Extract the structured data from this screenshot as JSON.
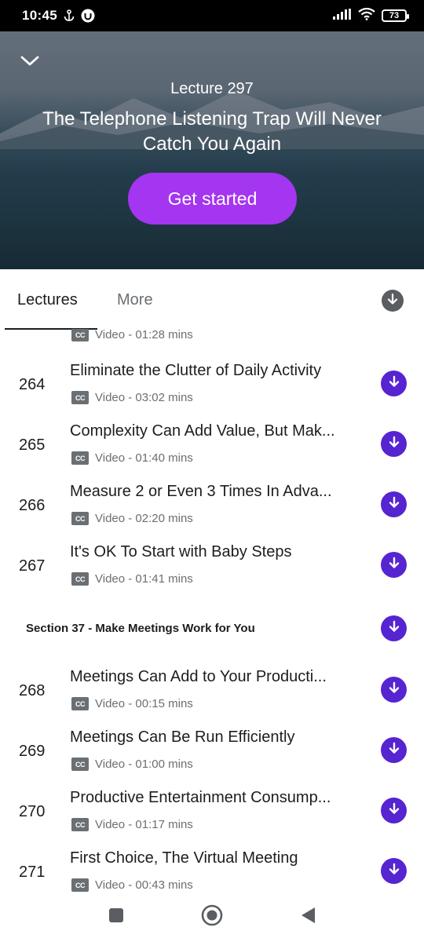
{
  "status_bar": {
    "time": "10:45",
    "battery": "73",
    "icons": [
      "anchor-icon",
      "app-notification-icon",
      "signal-icon",
      "wifi-icon",
      "battery-icon"
    ]
  },
  "hero": {
    "lecture_label": "Lecture 297",
    "title": "The Telephone Listening Trap Will Never Catch You Again",
    "cta_label": "Get started",
    "accent_color": "#a435f0"
  },
  "tabs": {
    "items": [
      "Lectures",
      "More"
    ],
    "active": "Lectures"
  },
  "list": {
    "download_color": "#5624d0",
    "partial_row": {
      "meta": "Video - 01:28 mins"
    },
    "rows_a": [
      {
        "num": "264",
        "title": "Eliminate the Clutter of Daily Activity",
        "meta": "Video - 03:02 mins"
      },
      {
        "num": "265",
        "title": "Complexity Can Add Value, But Mak...",
        "meta": "Video - 01:40 mins"
      },
      {
        "num": "266",
        "title": "Measure 2 or Even 3 Times In Adva...",
        "meta": "Video - 02:20 mins"
      },
      {
        "num": "267",
        "title": "It's OK To Start with Baby Steps",
        "meta": "Video - 01:41 mins"
      }
    ],
    "section": {
      "title": "Section 37 - Make Meetings Work for You"
    },
    "rows_b": [
      {
        "num": "268",
        "title": "Meetings Can Add to Your Producti...",
        "meta": "Video - 00:15 mins"
      },
      {
        "num": "269",
        "title": "Meetings Can Be Run Efficiently",
        "meta": "Video - 01:00 mins"
      },
      {
        "num": "270",
        "title": "Productive Entertainment Consump...",
        "meta": "Video - 01:17 mins"
      },
      {
        "num": "271",
        "title": "First Choice, The Virtual Meeting",
        "meta": "Video - 00:43 mins"
      }
    ],
    "cc_label": "CC"
  },
  "nav_bar": {
    "icons": [
      "recents-square-icon",
      "home-circle-icon",
      "back-triangle-icon"
    ]
  }
}
